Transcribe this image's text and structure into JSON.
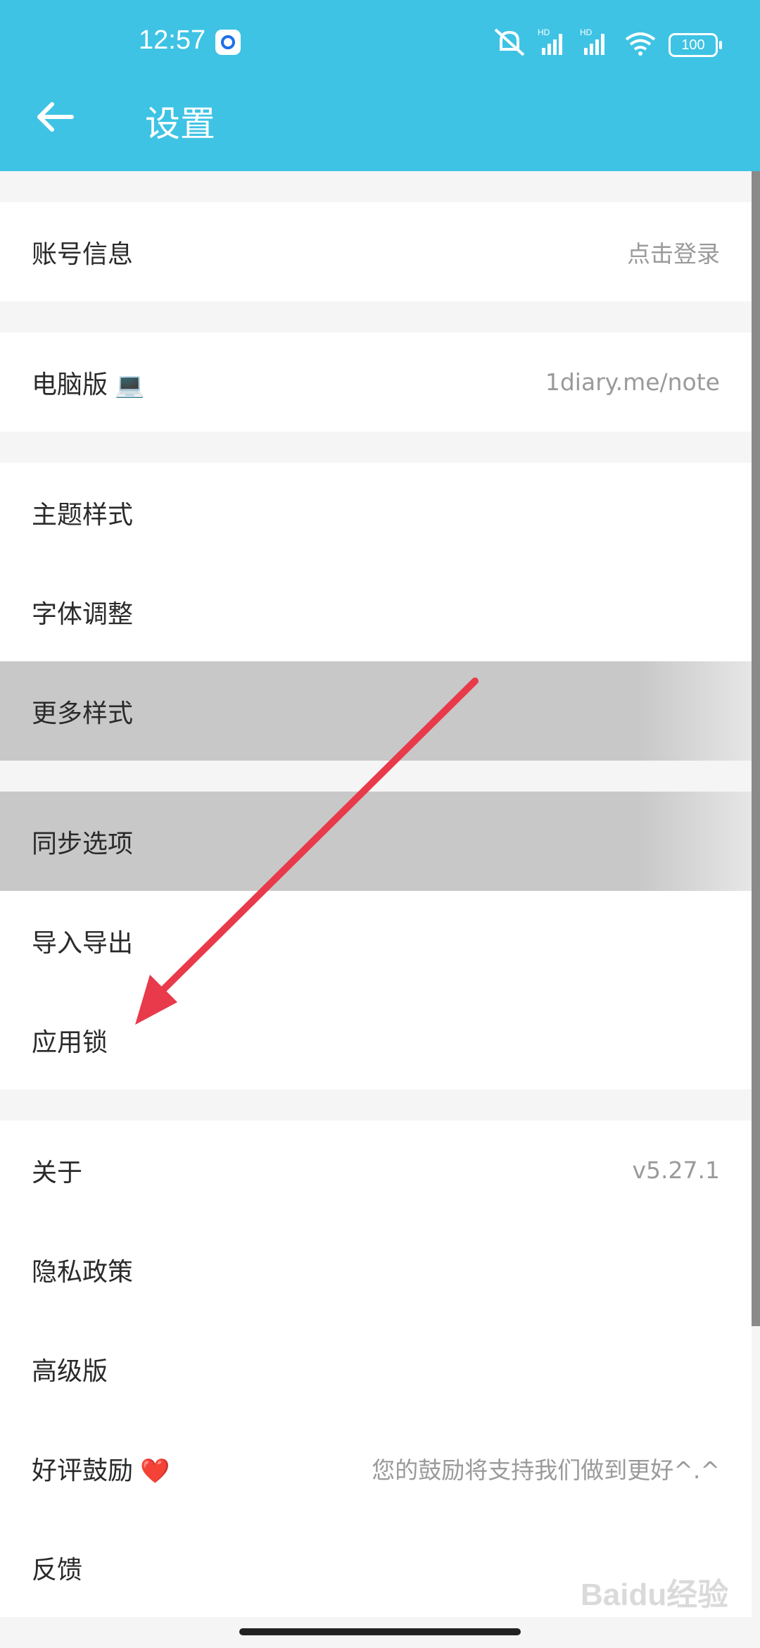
{
  "status_bar": {
    "time": "12:57",
    "battery": "100",
    "icons": [
      "app-notification-icon",
      "mute-icon",
      "signal-hd-icon",
      "signal-hd-icon",
      "wifi-icon",
      "battery-icon"
    ]
  },
  "header": {
    "title": "设置",
    "back_icon": "back-arrow-icon",
    "background_color": "#3ec3e4"
  },
  "settings": {
    "account": {
      "label": "账号信息",
      "value": "点击登录"
    },
    "desktop": {
      "label": "电脑版",
      "emoji": "💻",
      "value": "1diary.me/note"
    },
    "theme": {
      "label": "主题样式"
    },
    "font": {
      "label": "字体调整"
    },
    "more_styles": {
      "label": "更多样式"
    },
    "sync": {
      "label": "同步选项"
    },
    "import_export": {
      "label": "导入导出"
    },
    "app_lock": {
      "label": "应用锁"
    },
    "about": {
      "label": "关于",
      "value": "v5.27.1"
    },
    "privacy": {
      "label": "隐私政策"
    },
    "premium": {
      "label": "高级版"
    },
    "rate": {
      "label": "好评鼓励",
      "emoji": "❤️",
      "value": "您的鼓励将支持我们做到更好^.^"
    },
    "feedback": {
      "label": "反馈"
    }
  },
  "annotation": {
    "arrow_color": "#e83a4a"
  },
  "watermark": "Baidu经验"
}
